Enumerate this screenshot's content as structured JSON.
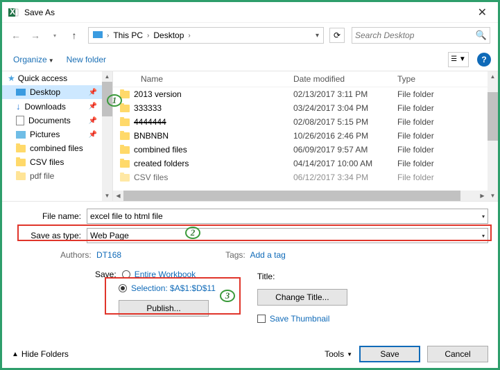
{
  "title": "Save As",
  "breadcrumbs": {
    "root": "This PC",
    "current": "Desktop"
  },
  "search_placeholder": "Search Desktop",
  "toolbar": {
    "organize": "Organize",
    "new_folder": "New folder"
  },
  "sidebar": {
    "quick_access": "Quick access",
    "items": [
      {
        "label": "Desktop"
      },
      {
        "label": "Downloads"
      },
      {
        "label": "Documents"
      },
      {
        "label": "Pictures"
      },
      {
        "label": "combined files"
      },
      {
        "label": "CSV files"
      },
      {
        "label": "pdf file"
      }
    ]
  },
  "columns": {
    "name": "Name",
    "modified": "Date modified",
    "type": "Type"
  },
  "files": [
    {
      "name": "2013 version",
      "modified": "02/13/2017 3:11 PM",
      "type": "File folder"
    },
    {
      "name": "333333",
      "modified": "03/24/2017 3:04 PM",
      "type": "File folder"
    },
    {
      "name": "4444444",
      "modified": "02/08/2017 5:15 PM",
      "type": "File folder"
    },
    {
      "name": "BNBNBN",
      "modified": "10/26/2016 2:46 PM",
      "type": "File folder"
    },
    {
      "name": "combined files",
      "modified": "06/09/2017 9:57 AM",
      "type": "File folder"
    },
    {
      "name": "created folders",
      "modified": "04/14/2017 10:00 AM",
      "type": "File folder"
    },
    {
      "name": "CSV files",
      "modified": "06/12/2017 3:34 PM",
      "type": "File folder"
    }
  ],
  "file_name_label": "File name:",
  "file_name_value": "excel file to html file",
  "save_type_label": "Save as type:",
  "save_type_value": "Web Page",
  "authors_label": "Authors:",
  "authors_value": "DT168",
  "tags_label": "Tags:",
  "tags_value": "Add a tag",
  "save_label": "Save:",
  "entire_workbook": "Entire Workbook",
  "selection": "Selection: $A$1:$D$11",
  "publish": "Publish...",
  "title_label": "Title:",
  "change_title": "Change Title...",
  "save_thumb": "Save Thumbnail",
  "hide_folders": "Hide Folders",
  "tools": "Tools",
  "save_btn": "Save",
  "cancel_btn": "Cancel",
  "annot": {
    "n1": "1",
    "n2": "2",
    "n3": "3"
  }
}
